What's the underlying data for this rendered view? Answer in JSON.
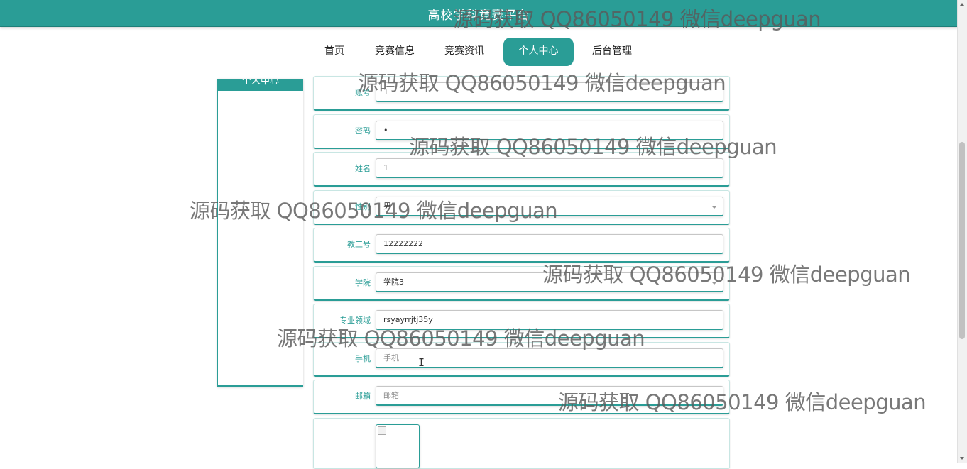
{
  "header": {
    "title": "高校学科竞赛平台"
  },
  "nav": {
    "items": [
      {
        "label": "首页"
      },
      {
        "label": "竞赛信息"
      },
      {
        "label": "竞赛资讯"
      },
      {
        "label": "个人中心",
        "active": true
      },
      {
        "label": "后台管理"
      }
    ]
  },
  "sidebar": {
    "title": "个人中心"
  },
  "form": {
    "account": {
      "label": "账号",
      "value": "1"
    },
    "password": {
      "label": "密码",
      "value": "•"
    },
    "name": {
      "label": "姓名",
      "value": "1"
    },
    "gender": {
      "label": "性别",
      "value": "男"
    },
    "staff_id": {
      "label": "教工号",
      "value": "12222222"
    },
    "college": {
      "label": "学院",
      "value": "学院3"
    },
    "specialty": {
      "label": "专业领域",
      "value": "rsyayrrjtj35y"
    },
    "phone": {
      "label": "手机",
      "placeholder": "手机"
    },
    "email": {
      "label": "邮箱",
      "placeholder": "邮箱"
    }
  },
  "cursor_glyph": "I",
  "watermark_text": "源码获取 QQ86050149 微信deepguan",
  "colors": {
    "accent": "#2a9d96",
    "background": "#ffffff"
  }
}
